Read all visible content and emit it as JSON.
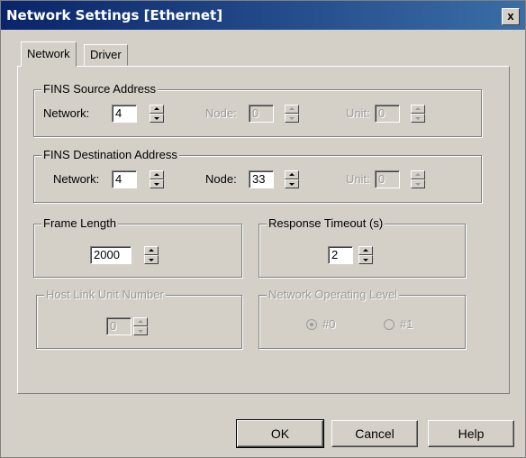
{
  "window": {
    "title": "Network Settings [Ethernet]",
    "close_label": "x"
  },
  "tabs": [
    {
      "label": "Network"
    },
    {
      "label": "Driver"
    }
  ],
  "fins_source": {
    "title": "FINS Source Address",
    "network_label": "Network:",
    "network_value": "4",
    "node_label": "Node:",
    "node_value": "0",
    "unit_label": "Unit:",
    "unit_value": "0"
  },
  "fins_destination": {
    "title": "FINS Destination Address",
    "network_label": "Network:",
    "network_value": "4",
    "node_label": "Node:",
    "node_value": "33",
    "unit_label": "Unit:",
    "unit_value": "0"
  },
  "frame_length": {
    "title": "Frame Length",
    "value": "2000"
  },
  "response_timeout": {
    "title": "Response Timeout (s)",
    "value": "2"
  },
  "host_link": {
    "title": "Host Link Unit Number",
    "value": "0"
  },
  "network_level": {
    "title": "Network Operating Level",
    "options": [
      {
        "label": "#0",
        "selected": true
      },
      {
        "label": "#1",
        "selected": false
      }
    ]
  },
  "buttons": {
    "ok": "OK",
    "cancel": "Cancel",
    "help": "Help"
  }
}
